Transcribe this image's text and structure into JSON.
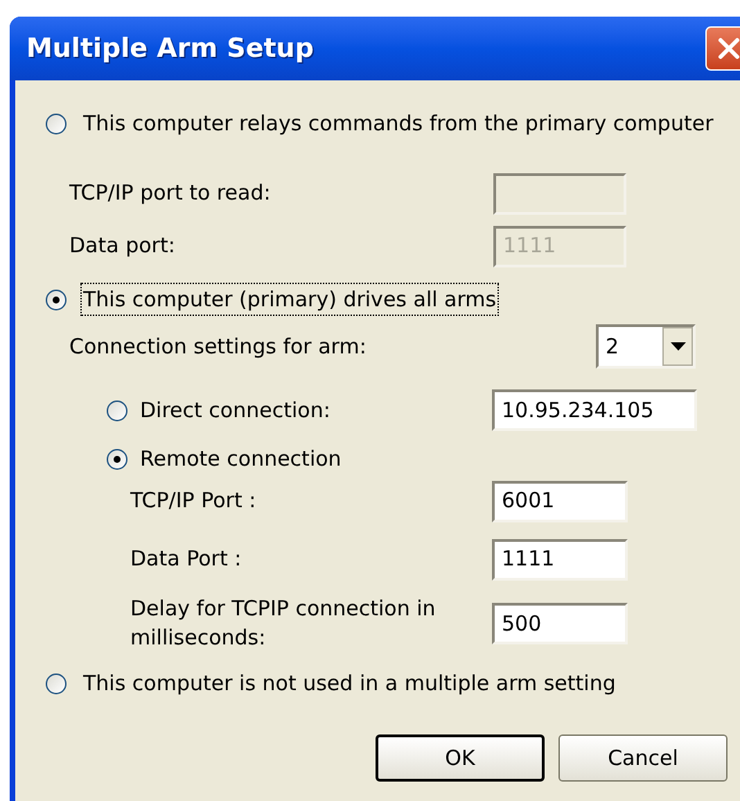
{
  "window": {
    "title": "Multiple Arm Setup"
  },
  "relay_option": {
    "label": "This computer relays commands from the primary computer",
    "selected": false,
    "fields": [
      {
        "label": "TCP/IP port to read:",
        "disabled": true
      },
      {
        "label": "Data port:",
        "value": "1111",
        "disabled": true
      }
    ]
  },
  "primary_option": {
    "label": "This computer (primary) drives all arms",
    "selected": true,
    "focused": true,
    "arm_label": "Connection settings for arm:",
    "arm_value": "2",
    "connections": [
      {
        "label": "Direct connection:",
        "selected": false,
        "value": "10.95.234.105"
      },
      {
        "label": "Remote connection",
        "selected": true
      }
    ],
    "remote_fields": [
      {
        "label": "TCP/IP Port :",
        "value": "6001"
      },
      {
        "label": "Data Port :",
        "value": "1111"
      },
      {
        "label": "Delay for TCPIP connection in milliseconds:",
        "value": "500"
      }
    ]
  },
  "standalone_option": {
    "label": "This computer is not used in a multiple arm setting",
    "selected": false
  },
  "buttons": [
    {
      "label": "OK",
      "default": true
    },
    {
      "label": "Cancel",
      "default": false
    }
  ]
}
